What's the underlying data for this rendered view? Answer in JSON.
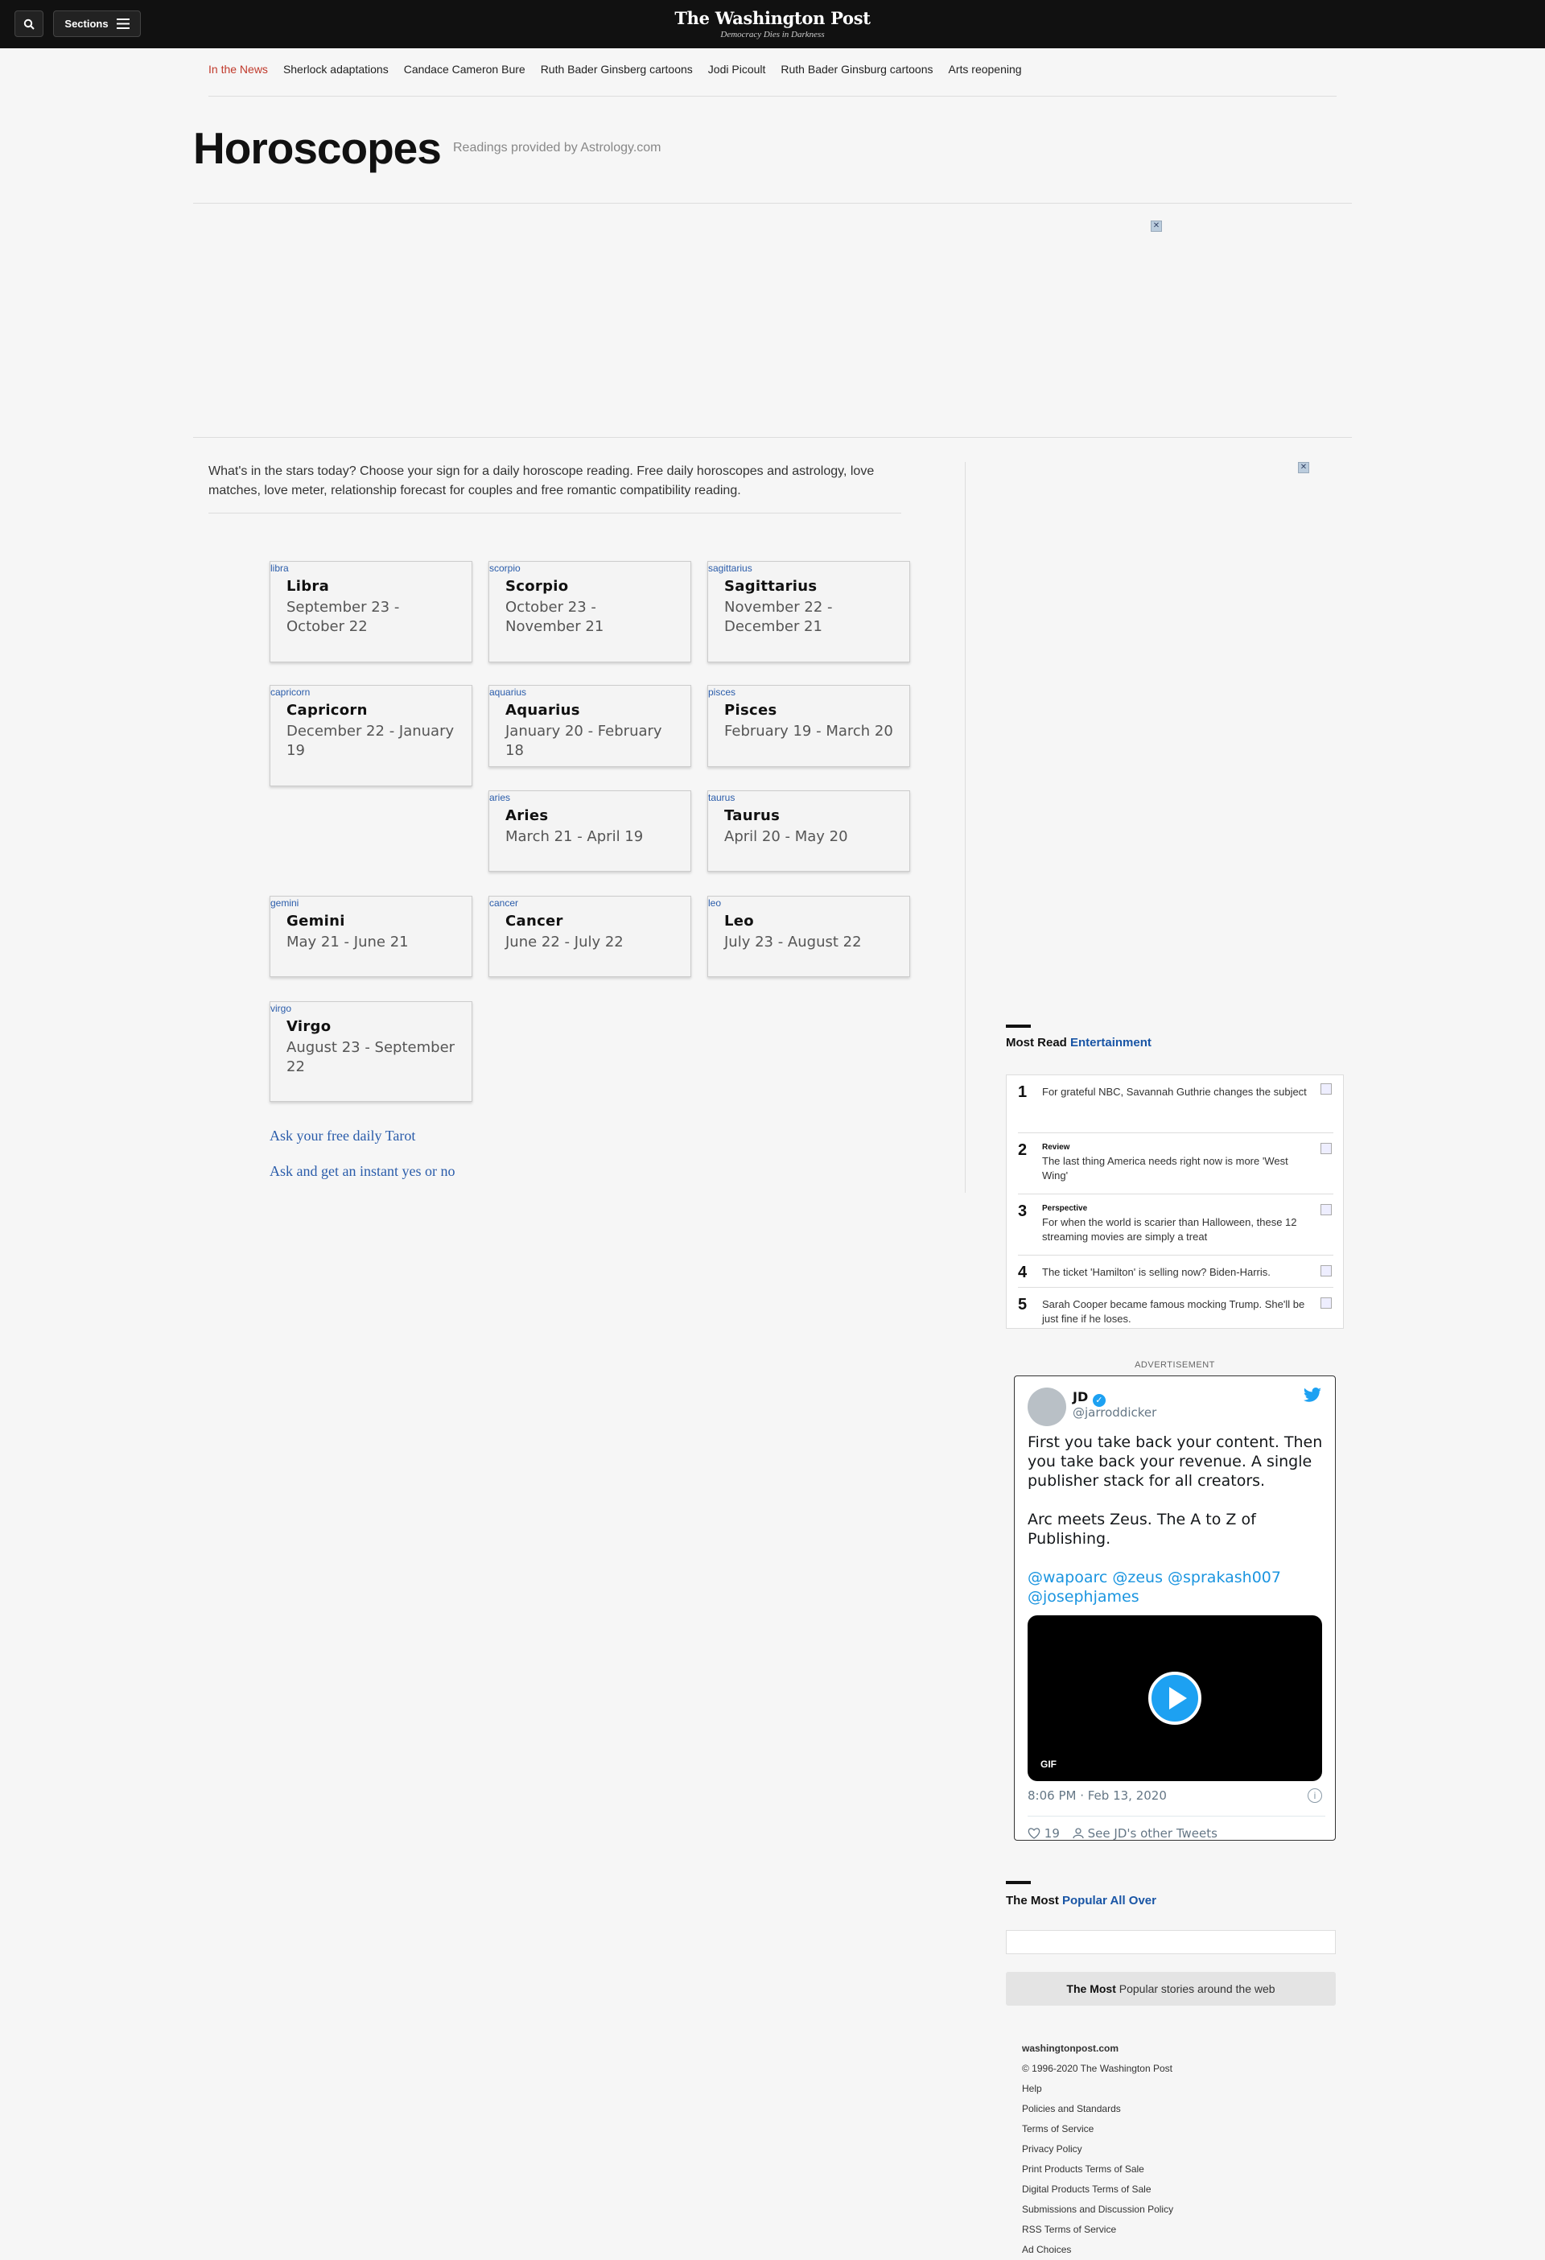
{
  "header": {
    "logo_name": "The Washington Post",
    "logo_tagline": "Democracy Dies in Darkness",
    "sections_label": "Sections"
  },
  "news_nav": {
    "label": "In the News",
    "items": [
      "Sherlock adaptations",
      "Candace Cameron Bure",
      "Ruth Bader Ginsberg cartoons",
      "Jodi Picoult",
      "Ruth Bader Ginsburg cartoons",
      "Arts reopening"
    ]
  },
  "page": {
    "title": "Horoscopes",
    "subtitle": "Readings provided by Astrology.com",
    "intro": "What's in the stars today? Choose your sign for a daily horoscope reading. Free daily horoscopes and astrology, love matches, love meter, relationship forecast for couples and free romantic compatibility reading."
  },
  "signs": [
    {
      "img": "libra",
      "name": "Libra",
      "dates": "September 23 - October 22"
    },
    {
      "img": "scorpio",
      "name": "Scorpio",
      "dates": "October 23 - November 21"
    },
    {
      "img": "sagittarius",
      "name": "Sagittarius",
      "dates": "November 22 - December 21"
    },
    {
      "img": "capricorn",
      "name": "Capricorn",
      "dates": "December 22 - January 19"
    },
    {
      "img": "aquarius",
      "name": "Aquarius",
      "dates": "January 20 - February 18"
    },
    {
      "img": "pisces",
      "name": "Pisces",
      "dates": "February 19 - March 20"
    },
    {
      "img": "aries",
      "name": "Aries",
      "dates": "March 21 - April 19"
    },
    {
      "img": "taurus",
      "name": "Taurus",
      "dates": "April 20 - May 20"
    },
    {
      "img": "gemini",
      "name": "Gemini",
      "dates": "May 21 - June 21"
    },
    {
      "img": "cancer",
      "name": "Cancer",
      "dates": "June 22 - July 22"
    },
    {
      "img": "leo",
      "name": "Leo",
      "dates": "July 23 - August 22"
    },
    {
      "img": "virgo",
      "name": "Virgo",
      "dates": "August 23 - September 22"
    }
  ],
  "links": {
    "tarot": "Ask your free daily Tarot",
    "yesno": "Ask and get an instant yes or no"
  },
  "most_read": {
    "title": "Most Read",
    "section": "Entertainment",
    "items": [
      {
        "num": "1",
        "kicker": "",
        "text": "For grateful NBC, Savannah Guthrie changes the subject"
      },
      {
        "num": "2",
        "kicker": "Review",
        "text": "The last thing America needs right now is more 'West Wing'"
      },
      {
        "num": "3",
        "kicker": "Perspective",
        "text": "For when the world is scarier than Halloween, these 12 streaming movies are simply a treat"
      },
      {
        "num": "4",
        "kicker": "",
        "text": "The ticket 'Hamilton' is selling now? Biden-Harris."
      },
      {
        "num": "5",
        "kicker": "",
        "text": "Sarah Cooper became famous mocking Trump. She'll be just fine if he loses."
      }
    ]
  },
  "advertisement_label": "ADVERTISEMENT",
  "tweet": {
    "name": "JD",
    "handle": "@jarroddicker",
    "para1": "First you take back your content. Then you take back your revenue. A single publisher stack for all creators.",
    "para2": "Arc meets Zeus. The A to Z of Publishing.",
    "mentions": "@wapoarc @zeus @sprakash007 @josephjames",
    "media_label": "GIF",
    "date": "8:06 PM · Feb 13, 2020",
    "likes": "19",
    "other": "See JD's other Tweets"
  },
  "popular": {
    "title_plain": "The Most",
    "title_accent": "Popular All Over",
    "bar_bold": "The Most",
    "bar_text": "Popular stories around the web"
  },
  "footer": {
    "site": "washingtonpost.com",
    "items": [
      "© 1996-2020 The Washington Post",
      "Help",
      "Policies and Standards",
      "Terms of Service",
      "Privacy Policy",
      "Print Products Terms of Sale",
      "Digital Products Terms of Sale",
      "Submissions and Discussion Policy",
      "RSS Terms of Service",
      "Ad Choices"
    ]
  },
  "colors": {
    "topbar": "#111111",
    "accent_link": "#2a5caa",
    "in_the_news": "#c0392b",
    "twitter_blue": "#1da1f2"
  }
}
